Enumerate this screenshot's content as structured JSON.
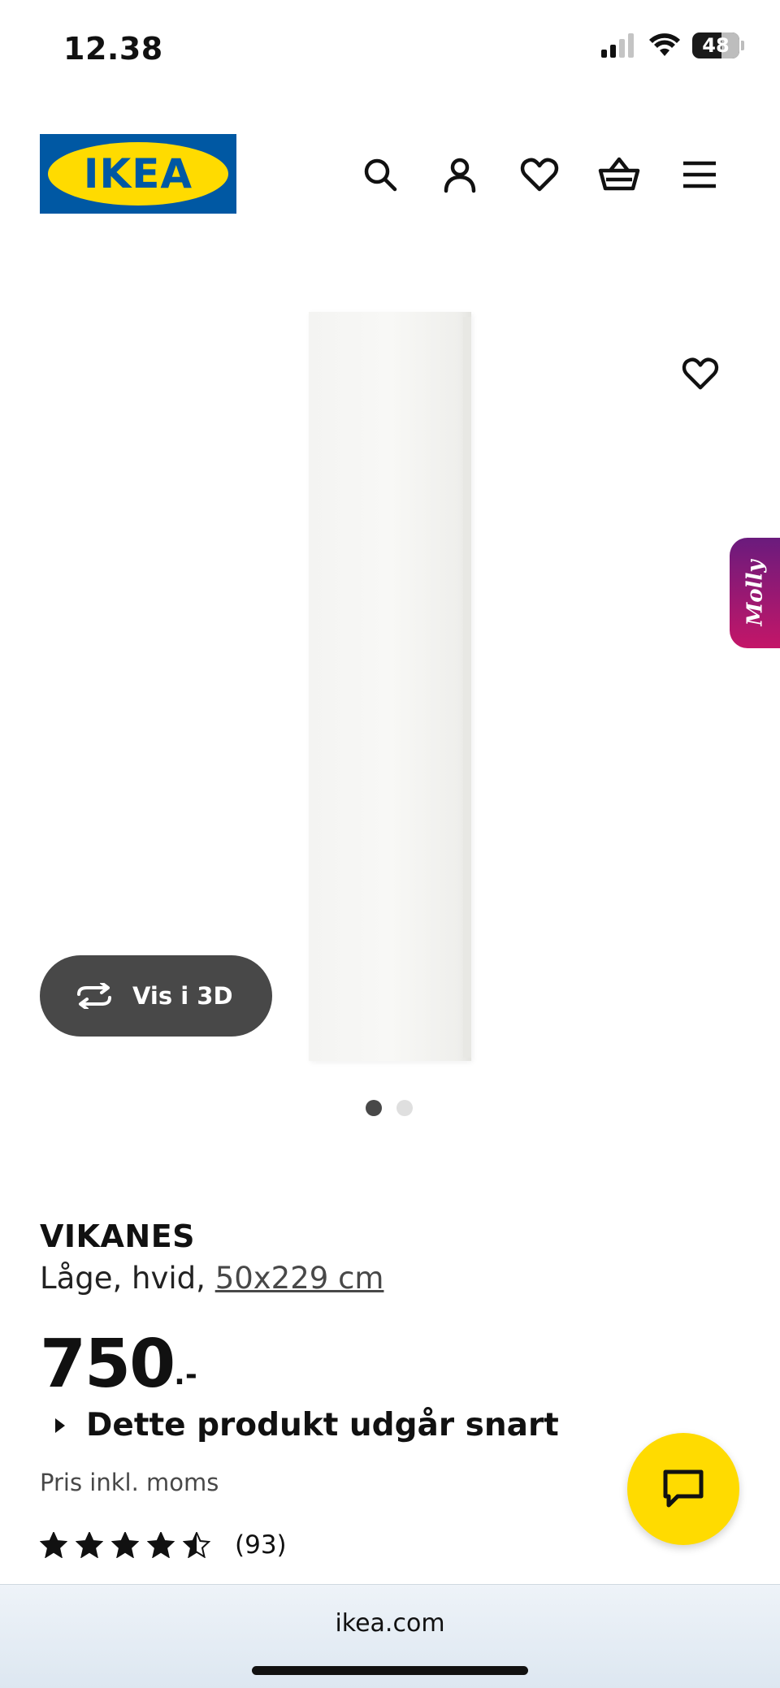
{
  "status_bar": {
    "time": "12.38",
    "battery": "48",
    "signal_icon": "cellular-signal-icon",
    "wifi_icon": "wifi-icon"
  },
  "header": {
    "logo_text": "IKEA",
    "icons": [
      "search-icon",
      "account-icon",
      "heart-icon",
      "basket-icon",
      "menu-icon"
    ]
  },
  "gallery": {
    "molly_label": "Molly",
    "vis3d_label": "Vis i 3D",
    "slide_count": 2,
    "active_slide": 1
  },
  "product": {
    "name": "VIKANES",
    "description": "Låge, hvid,",
    "size": "50x229 cm",
    "price": "750",
    "price_suffix": ".-",
    "notice": "Dette produkt udgår snart",
    "price_note": "Pris inkl. moms",
    "rating": 4.5,
    "rating_max": 5,
    "review_count": "(93)"
  },
  "browser": {
    "url": "ikea.com"
  },
  "colors": {
    "brand_blue": "#0058a3",
    "brand_yellow": "#ffdb00",
    "button_dark": "#484848"
  }
}
